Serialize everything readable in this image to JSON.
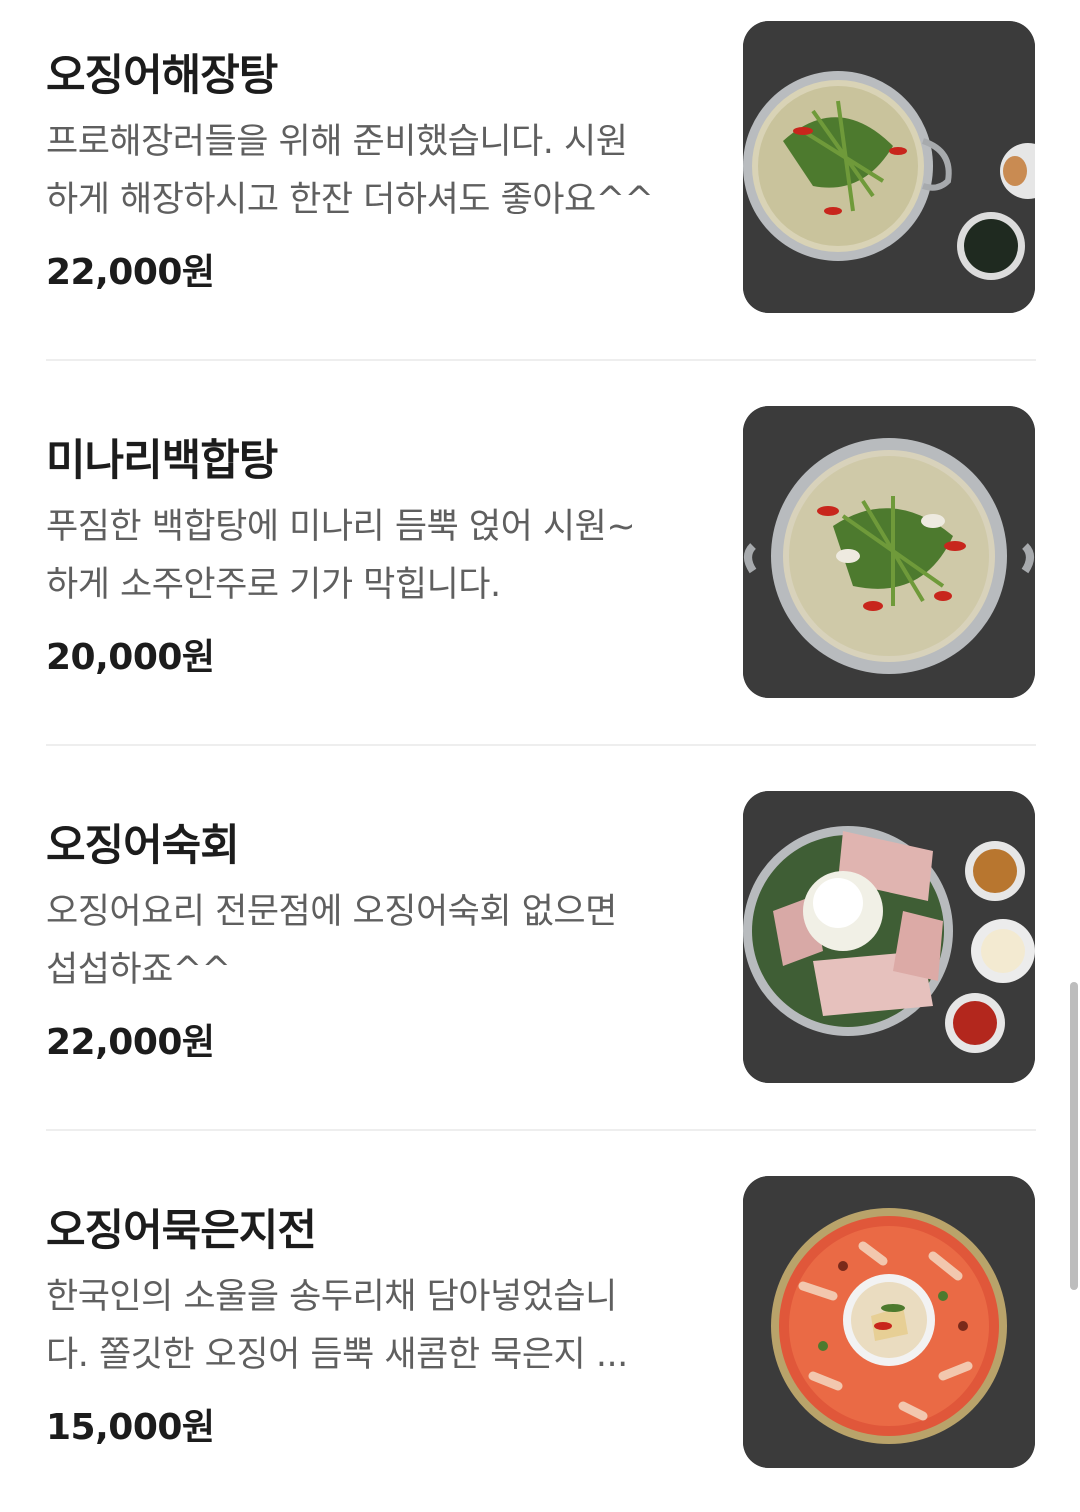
{
  "menu_items": [
    {
      "name": "오징어해장탕",
      "desc_line1": "프로해장러들을 위해 준비했습니다. 시원",
      "desc_line2": "하게 해장하시고 한잔 더하셔도 좋아요^^",
      "price": "22,000원",
      "image": "squid-hangover-soup-photo"
    },
    {
      "name": "미나리백합탕",
      "desc_line1": "푸짐한 백합탕에 미나리 듬뿍 얹어 시원~",
      "desc_line2": "하게 소주안주로 기가 막힙니다.",
      "price": "20,000원",
      "image": "clam-water-parsley-soup-photo"
    },
    {
      "name": "오징어숙회",
      "desc_line1": "오징어요리 전문점에 오징어숙회 없으면",
      "desc_line2": "섭섭하죠^^",
      "price": "22,000원",
      "image": "boiled-squid-platter-photo"
    },
    {
      "name": "오징어묵은지전",
      "desc_line1": "한국인의 소울을 송두리채 담아넣었습니",
      "desc_line2": "다. 쫄깃한 오징어 듬뿍 새콤한 묵은지 ...",
      "price": "15,000원",
      "image": "squid-kimchi-pancake-photo"
    }
  ]
}
